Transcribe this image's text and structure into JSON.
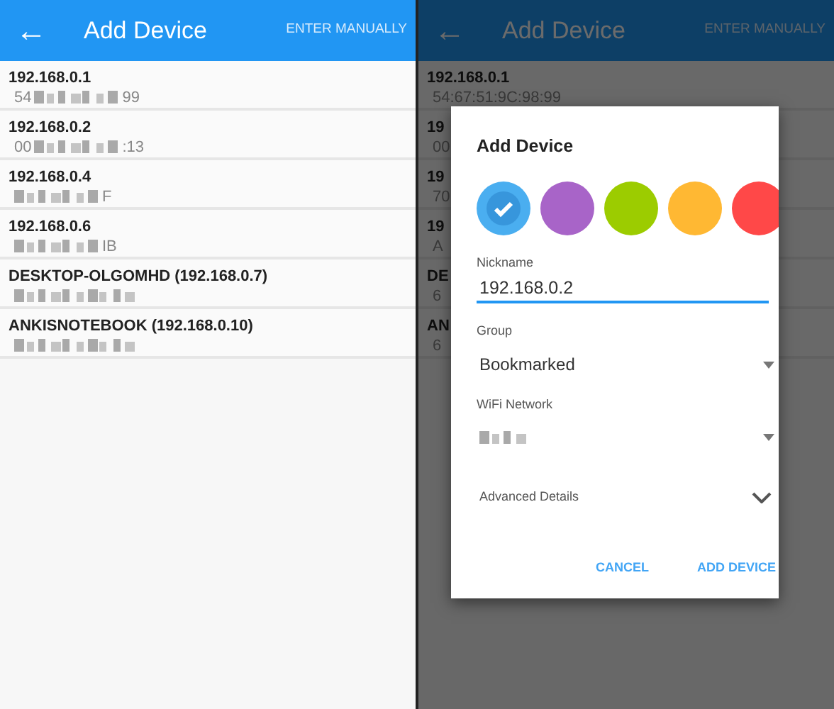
{
  "screens": [
    {
      "appbar": {
        "back": "←",
        "title": "Add Device",
        "action": "ENTER MANUALLY"
      },
      "dimmed": false,
      "devices": [
        {
          "name": "192.168.0.1",
          "mac_start": "54",
          "mac_end": "99",
          "redacted": true
        },
        {
          "name": "192.168.0.2",
          "mac_start": "00",
          "mac_end": ":13",
          "redacted": true
        },
        {
          "name": "192.168.0.4",
          "mac_end": "F",
          "redacted": true
        },
        {
          "name": "192.168.0.6",
          "mac_end": "IB",
          "redacted": true
        },
        {
          "name": "DESKTOP-OLGOMHD (192.168.0.7)",
          "redacted": true
        },
        {
          "name": "ANKISNOTEBOOK (192.168.0.10)",
          "redacted": true
        }
      ]
    },
    {
      "appbar": {
        "back": "←",
        "title": "Add Device",
        "action": "ENTER MANUALLY"
      },
      "dimmed": true,
      "devices": [
        {
          "name": "192.168.0.1",
          "mac_start": "54:67:51:9C:98:99",
          "redacted": false
        },
        {
          "name": "19",
          "mac_start": "00",
          "redacted": false
        },
        {
          "name": "19",
          "mac_start": "70",
          "redacted": false
        },
        {
          "name": "19",
          "mac_start": "A",
          "redacted": false
        },
        {
          "name": "DE",
          "mac_start": "6",
          "redacted": false
        },
        {
          "name": "AN",
          "mac_start": "6",
          "redacted": false
        }
      ]
    }
  ],
  "dialog": {
    "title": "Add Device",
    "colors": [
      {
        "color": "#4aaef0",
        "selected": true
      },
      {
        "color": "#a864c8",
        "selected": false
      },
      {
        "color": "#9ccc00",
        "selected": false
      },
      {
        "color": "#ffb833",
        "selected": false
      },
      {
        "color": "#ff4848",
        "selected": false
      }
    ],
    "nickname": {
      "label": "Nickname",
      "value": "192.168.0.2"
    },
    "group": {
      "label": "Group",
      "value": "Bookmarked"
    },
    "wifi": {
      "label": "WiFi Network",
      "redacted": true
    },
    "advanced": {
      "label": "Advanced Details",
      "expanded": false
    },
    "buttons": [
      "CANCEL",
      "ADD DEVICE"
    ]
  }
}
